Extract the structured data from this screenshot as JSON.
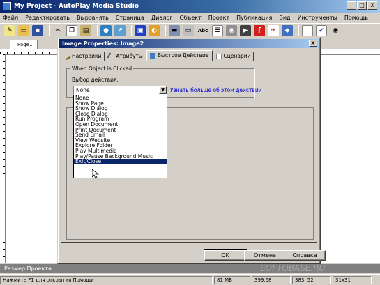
{
  "window": {
    "title": "My Project - AutoPlay Media Studio",
    "min": "_",
    "max": "□",
    "close": "X"
  },
  "menu": [
    "Файл",
    "Редактировать",
    "Выровнять",
    "Страница",
    "Диалог",
    "Объект",
    "Проект",
    "Публикация",
    "Вид",
    "Инструменты",
    "Помощь"
  ],
  "toolbar": {
    "icons": [
      "new-icon",
      "open-icon",
      "save-icon",
      "cut-icon",
      "copy-icon",
      "paste-icon",
      "globe-icon",
      "web-icon",
      "image-icon",
      "flash-icon",
      "button-icon",
      "label-icon",
      "text-icon",
      "listbox-icon",
      "cd-icon",
      "video-icon",
      "flash-object-icon",
      "pdf-icon",
      "web-object-icon",
      "input-icon",
      "checkbox-icon",
      "radio-icon"
    ],
    "abc": "Abc"
  },
  "pagetabs": {
    "page1": "Page1"
  },
  "dialog": {
    "title": "Image Properties: Image2",
    "close": "X",
    "tabs": [
      "Настройки",
      "Атрибуты",
      "Быстрое Действие",
      "Сценарий"
    ],
    "active_tab": 2,
    "group_label": "When Object is Clicked",
    "field_label": "Выбор действия:",
    "combo_value": "None",
    "link_text": "Узнать больше об этом действии",
    "options": [
      "None",
      "Show Page",
      "Show Dialog",
      "Close Dialog",
      "Run Program",
      "Open Document",
      "Print Document",
      "Send Email",
      "View Website",
      "Explore Folder",
      "Play Multimedia",
      "Play/Pause Background Music",
      "Exit/Close"
    ],
    "highlighted_option": "Exit/Close",
    "buttons": {
      "ok": "OK",
      "cancel": "Отмена",
      "help": "Справка"
    }
  },
  "bottom": {
    "project_size": "Размер Проекта",
    "watermark": "SOFTOBASE.RU"
  },
  "status": {
    "help": "Нажмите F1 для открытия Помощи",
    "size": "81 MB",
    "position": "399,68",
    "size2": "383, 52",
    "dims": "31x31"
  }
}
